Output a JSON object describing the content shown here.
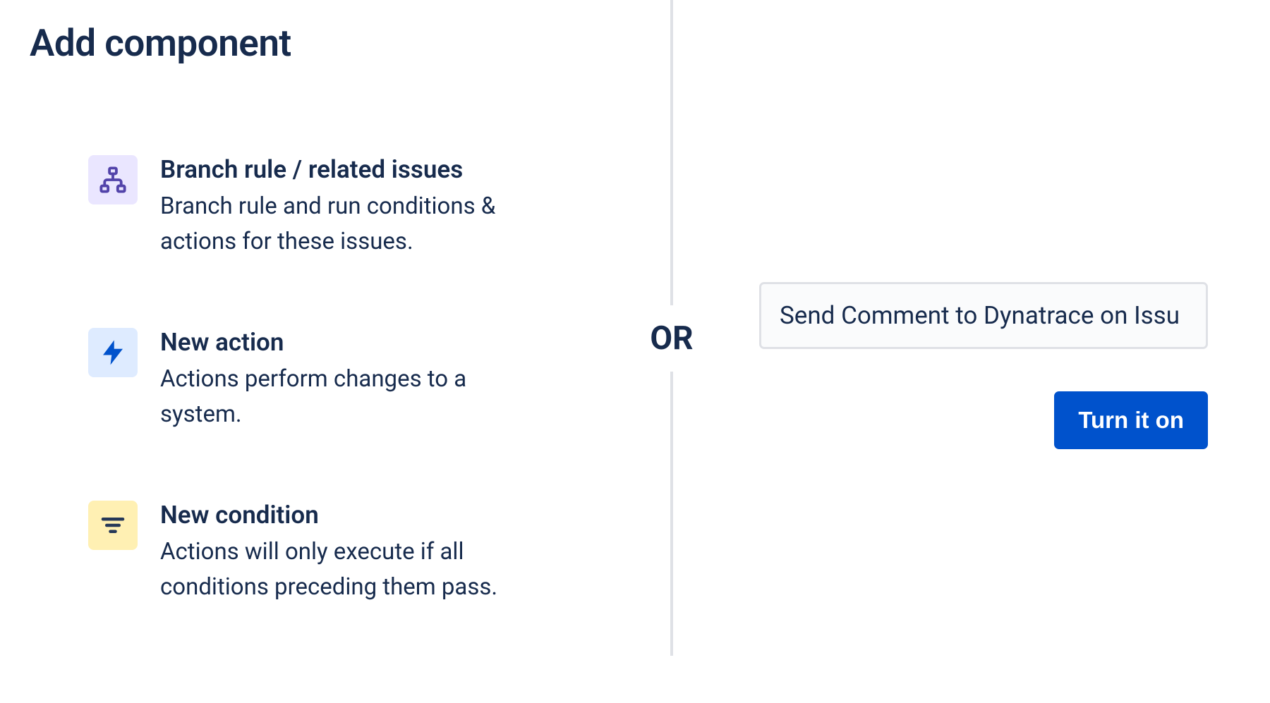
{
  "title": "Add component",
  "components": [
    {
      "key": "branch",
      "icon": "branch-rule-icon",
      "title": "Branch rule / related issues",
      "description": "Branch rule and run conditions & actions for these issues."
    },
    {
      "key": "action",
      "icon": "lightning-icon",
      "title": "New action",
      "description": "Actions perform changes to a system."
    },
    {
      "key": "condition",
      "icon": "filter-icon",
      "title": "New condition",
      "description": "Actions will only execute if all conditions preceding them pass."
    }
  ],
  "divider_label": "OR",
  "rule_name_input": {
    "value": "Send Comment to Dynatrace on Issu",
    "placeholder": ""
  },
  "primary_button": "Turn it on",
  "colors": {
    "brand_primary": "#0052CC",
    "text": "#172B4D",
    "icon_bg_purple": "#EAE6FF",
    "icon_bg_blue": "#DEEBFF",
    "icon_bg_yellow": "#FFF0B3",
    "icon_purple": "#5243AA",
    "icon_blue": "#0052CC",
    "icon_dark": "#42526E",
    "border": "#DFE1E6",
    "input_bg": "#FAFBFC"
  }
}
